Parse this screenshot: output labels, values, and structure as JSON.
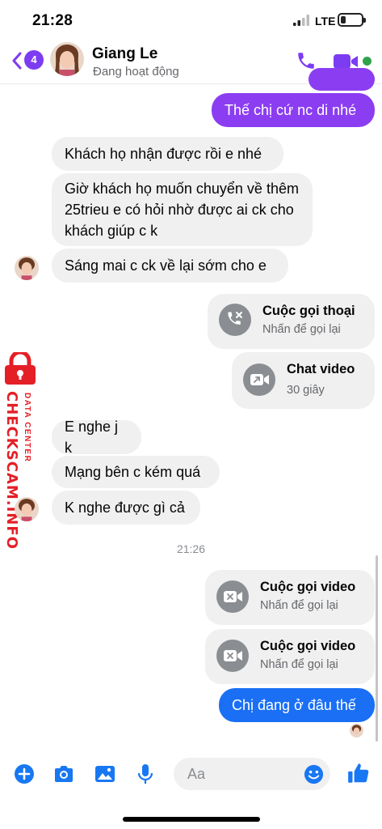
{
  "status_bar": {
    "time": "21:28",
    "network": "LTE"
  },
  "header": {
    "unread_count": "4",
    "contact_name": "Giang Le",
    "contact_status": "Đang hoạt động",
    "colors": {
      "accent": "#7c3cf2",
      "online": "#31a24c"
    }
  },
  "messages": {
    "out_1": "Thế chị cứ nc di nhé",
    "in_1": "Khách họ nhận được rồi e nhé",
    "in_2": "Giờ khách họ muốn chuyển về thêm 25trieu e có hỏi nhờ được ai ck cho khách giúp c k",
    "in_3": "Sáng mai c ck về lại sớm cho e",
    "call_1": {
      "title": "Cuộc gọi thoại",
      "subtitle": "Nhấn để gọi lại"
    },
    "call_2": {
      "title": "Chat video",
      "subtitle": "30 giây"
    },
    "in_4": "E nghe j k",
    "in_5": "Mạng bên c kém quá",
    "in_6": "K nghe được gì cả",
    "timestamp": "21:26",
    "call_3": {
      "title": "Cuộc gọi video",
      "subtitle": "Nhấn để gọi lại"
    },
    "call_4": {
      "title": "Cuộc gọi video",
      "subtitle": "Nhấn để gọi lại"
    },
    "out_2": "Chị đang ở đâu thế"
  },
  "watermark": {
    "brand": "CHECKSCAM.INFO",
    "tagline": "DATA CENTER",
    "color": "#e41f26"
  },
  "composer": {
    "placeholder": "Aa",
    "icons": [
      "plus-icon",
      "camera-icon",
      "image-icon",
      "microphone-icon",
      "emoji-icon",
      "like-icon"
    ],
    "color": "#1877f2"
  },
  "bubble_colors": {
    "outgoing_purple": "#8b3df2",
    "outgoing_blue": "#1a6ff5",
    "incoming": "#f0f0f0"
  }
}
